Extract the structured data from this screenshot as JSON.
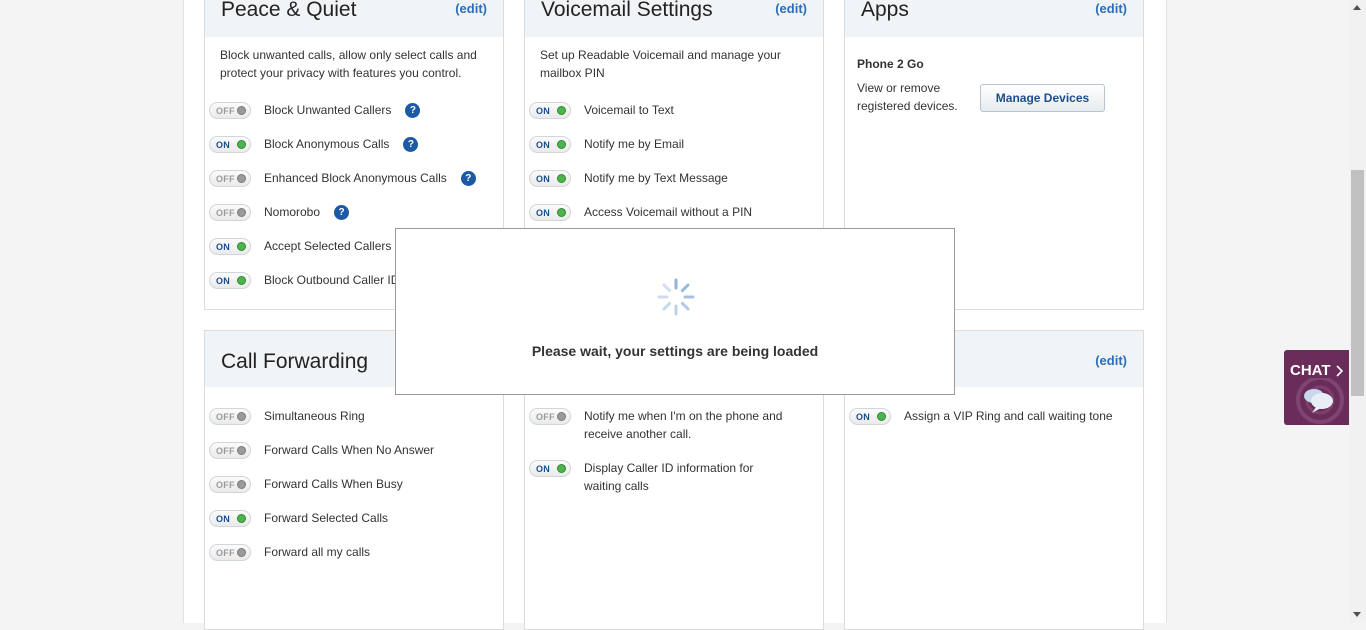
{
  "cards": {
    "peace": {
      "title": "Peace & Quiet",
      "edit": "(edit)",
      "description": "Block unwanted calls, allow only select calls and protect your privacy with features you control.",
      "rows": [
        {
          "state": "OFF",
          "label": "Block Unwanted Callers",
          "help": "?"
        },
        {
          "state": "ON",
          "label": "Block Anonymous Calls",
          "help": "?"
        },
        {
          "state": "OFF",
          "label": "Enhanced Block Anonymous Calls",
          "help": "?"
        },
        {
          "state": "OFF",
          "label": "Nomorobo",
          "help": "?"
        },
        {
          "state": "ON",
          "label": "Accept Selected Callers"
        },
        {
          "state": "ON",
          "label": "Block Outbound Caller ID"
        }
      ]
    },
    "voicemail": {
      "title": "Voicemail Settings",
      "edit": "(edit)",
      "description": "Set up Readable Voicemail and manage your mailbox PIN",
      "rows": [
        {
          "state": "ON",
          "label": "Voicemail to Text"
        },
        {
          "state": "ON",
          "label": "Notify me by Email"
        },
        {
          "state": "ON",
          "label": "Notify me by Text Message"
        },
        {
          "state": "ON",
          "label": "Access Voicemail without a PIN"
        }
      ]
    },
    "apps": {
      "title": "Apps",
      "edit": "(edit)",
      "app_name": "Phone 2 Go",
      "app_desc": "View or remove registered devices.",
      "button": "Manage Devices"
    },
    "forwarding": {
      "title": "Call Forwarding",
      "rows": [
        {
          "state": "OFF",
          "label": "Simultaneous Ring"
        },
        {
          "state": "OFF",
          "label": "Forward Calls When No Answer"
        },
        {
          "state": "OFF",
          "label": "Forward Calls When Busy"
        },
        {
          "state": "ON",
          "label": "Forward Selected Calls"
        },
        {
          "state": "OFF",
          "label": "Forward all my calls"
        }
      ]
    },
    "waiting": {
      "rows": [
        {
          "state": "OFF",
          "label": "Notify me when I'm on the phone and receive another call."
        },
        {
          "state": "ON",
          "label": "Display Caller ID information for waiting calls"
        }
      ]
    },
    "vip": {
      "edit": "(edit)",
      "rows": [
        {
          "state": "ON",
          "label": "Assign a VIP Ring and call waiting tone"
        }
      ]
    }
  },
  "overlay": {
    "message": "Please wait, your settings are being loaded"
  },
  "chat": {
    "label": "CHAT"
  },
  "colors": {
    "link": "#2a6ebb",
    "on_dot": "#4db34d",
    "help_icon": "#1d5aa5",
    "chat_bg": "#6a2c59"
  }
}
